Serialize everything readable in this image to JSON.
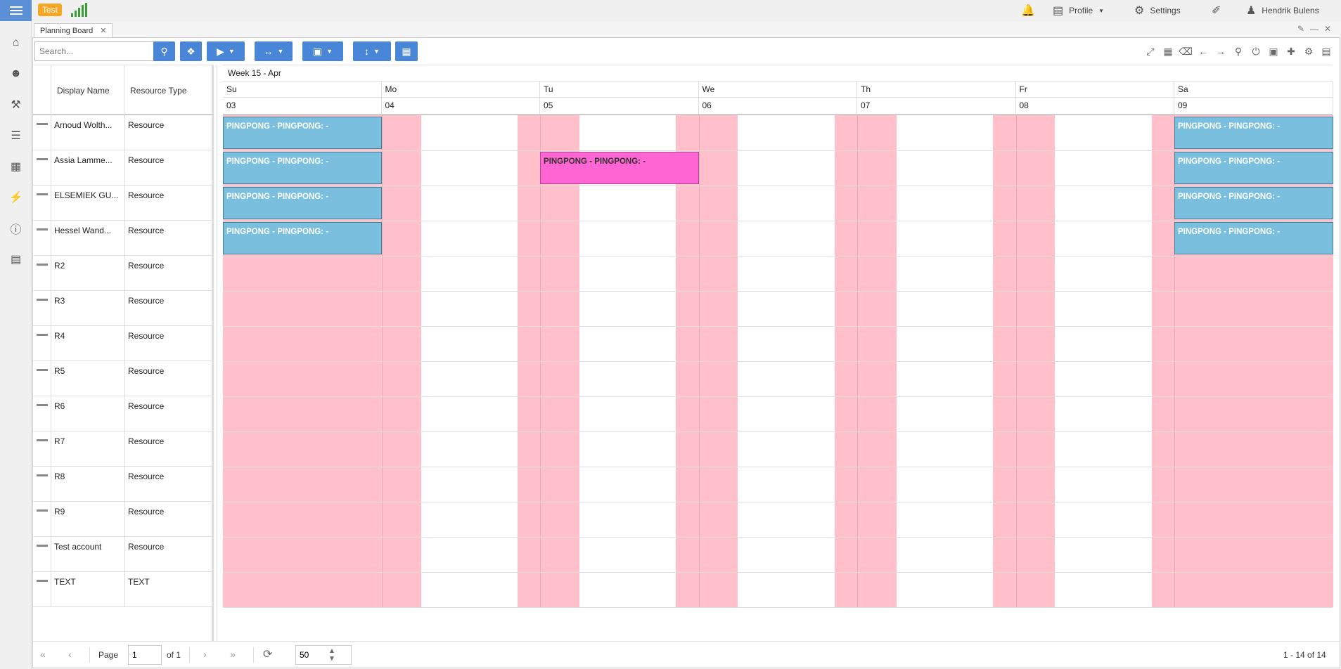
{
  "topbar": {
    "env_badge": "Test",
    "profile_label": "Profile",
    "settings_label": "Settings",
    "user_name": "Hendrik Bulens"
  },
  "tabs": [
    {
      "label": "Planning Board"
    }
  ],
  "toolbar": {
    "search_placeholder": "Search..."
  },
  "grid": {
    "columns": {
      "display_name": "Display Name",
      "resource_type": "Resource Type"
    },
    "rows": [
      {
        "name": "Arnoud Wolth...",
        "type": "Resource"
      },
      {
        "name": "Assia Lamme...",
        "type": "Resource"
      },
      {
        "name": "ELSEMIEK GU...",
        "type": "Resource"
      },
      {
        "name": "Hessel Wand...",
        "type": "Resource"
      },
      {
        "name": "R2",
        "type": "Resource"
      },
      {
        "name": "R3",
        "type": "Resource"
      },
      {
        "name": "R4",
        "type": "Resource"
      },
      {
        "name": "R5",
        "type": "Resource"
      },
      {
        "name": "R6",
        "type": "Resource"
      },
      {
        "name": "R7",
        "type": "Resource"
      },
      {
        "name": "R8",
        "type": "Resource"
      },
      {
        "name": "R9",
        "type": "Resource"
      },
      {
        "name": "Test account",
        "type": "Resource"
      },
      {
        "name": "TEXT",
        "type": "TEXT"
      }
    ]
  },
  "timeline": {
    "week_label": "Week 15 - Apr",
    "days": [
      {
        "day": "Su",
        "date": "03"
      },
      {
        "day": "Mo",
        "date": "04"
      },
      {
        "day": "Tu",
        "date": "05"
      },
      {
        "day": "We",
        "date": "06"
      },
      {
        "day": "Th",
        "date": "07"
      },
      {
        "day": "Fr",
        "date": "08"
      },
      {
        "day": "Sa",
        "date": "09"
      }
    ],
    "events": [
      {
        "row": 0,
        "day": 0,
        "label": "PINGPONG - PINGPONG: -",
        "color": "#7ac0de"
      },
      {
        "row": 0,
        "day": 6,
        "label": "PINGPONG - PINGPONG: -",
        "color": "#7ac0de"
      },
      {
        "row": 1,
        "day": 0,
        "label": "PINGPONG - PINGPONG: -",
        "color": "#7ac0de"
      },
      {
        "row": 1,
        "day": 2,
        "label": "PINGPONG - PINGPONG: -",
        "color": "#ff66d4"
      },
      {
        "row": 1,
        "day": 6,
        "label": "PINGPONG - PINGPONG: -",
        "color": "#7ac0de"
      },
      {
        "row": 2,
        "day": 0,
        "label": "PINGPONG - PINGPONG: -",
        "color": "#7ac0de"
      },
      {
        "row": 2,
        "day": 6,
        "label": "PINGPONG - PINGPONG: -",
        "color": "#7ac0de"
      },
      {
        "row": 3,
        "day": 0,
        "label": "PINGPONG - PINGPONG: -",
        "color": "#7ac0de"
      },
      {
        "row": 3,
        "day": 6,
        "label": "PINGPONG - PINGPONG: -",
        "color": "#7ac0de"
      }
    ]
  },
  "pager": {
    "page_label": "Page",
    "page_value": "1",
    "of_label": "of 1",
    "page_size": "50",
    "summary": "1 - 14 of 14"
  },
  "colors": {
    "accent": "#4a86d8",
    "nonworking": "#ffc0cb",
    "event_blue": "#7ac0de",
    "event_pink": "#ff66d4",
    "badge": "#f5a623"
  }
}
